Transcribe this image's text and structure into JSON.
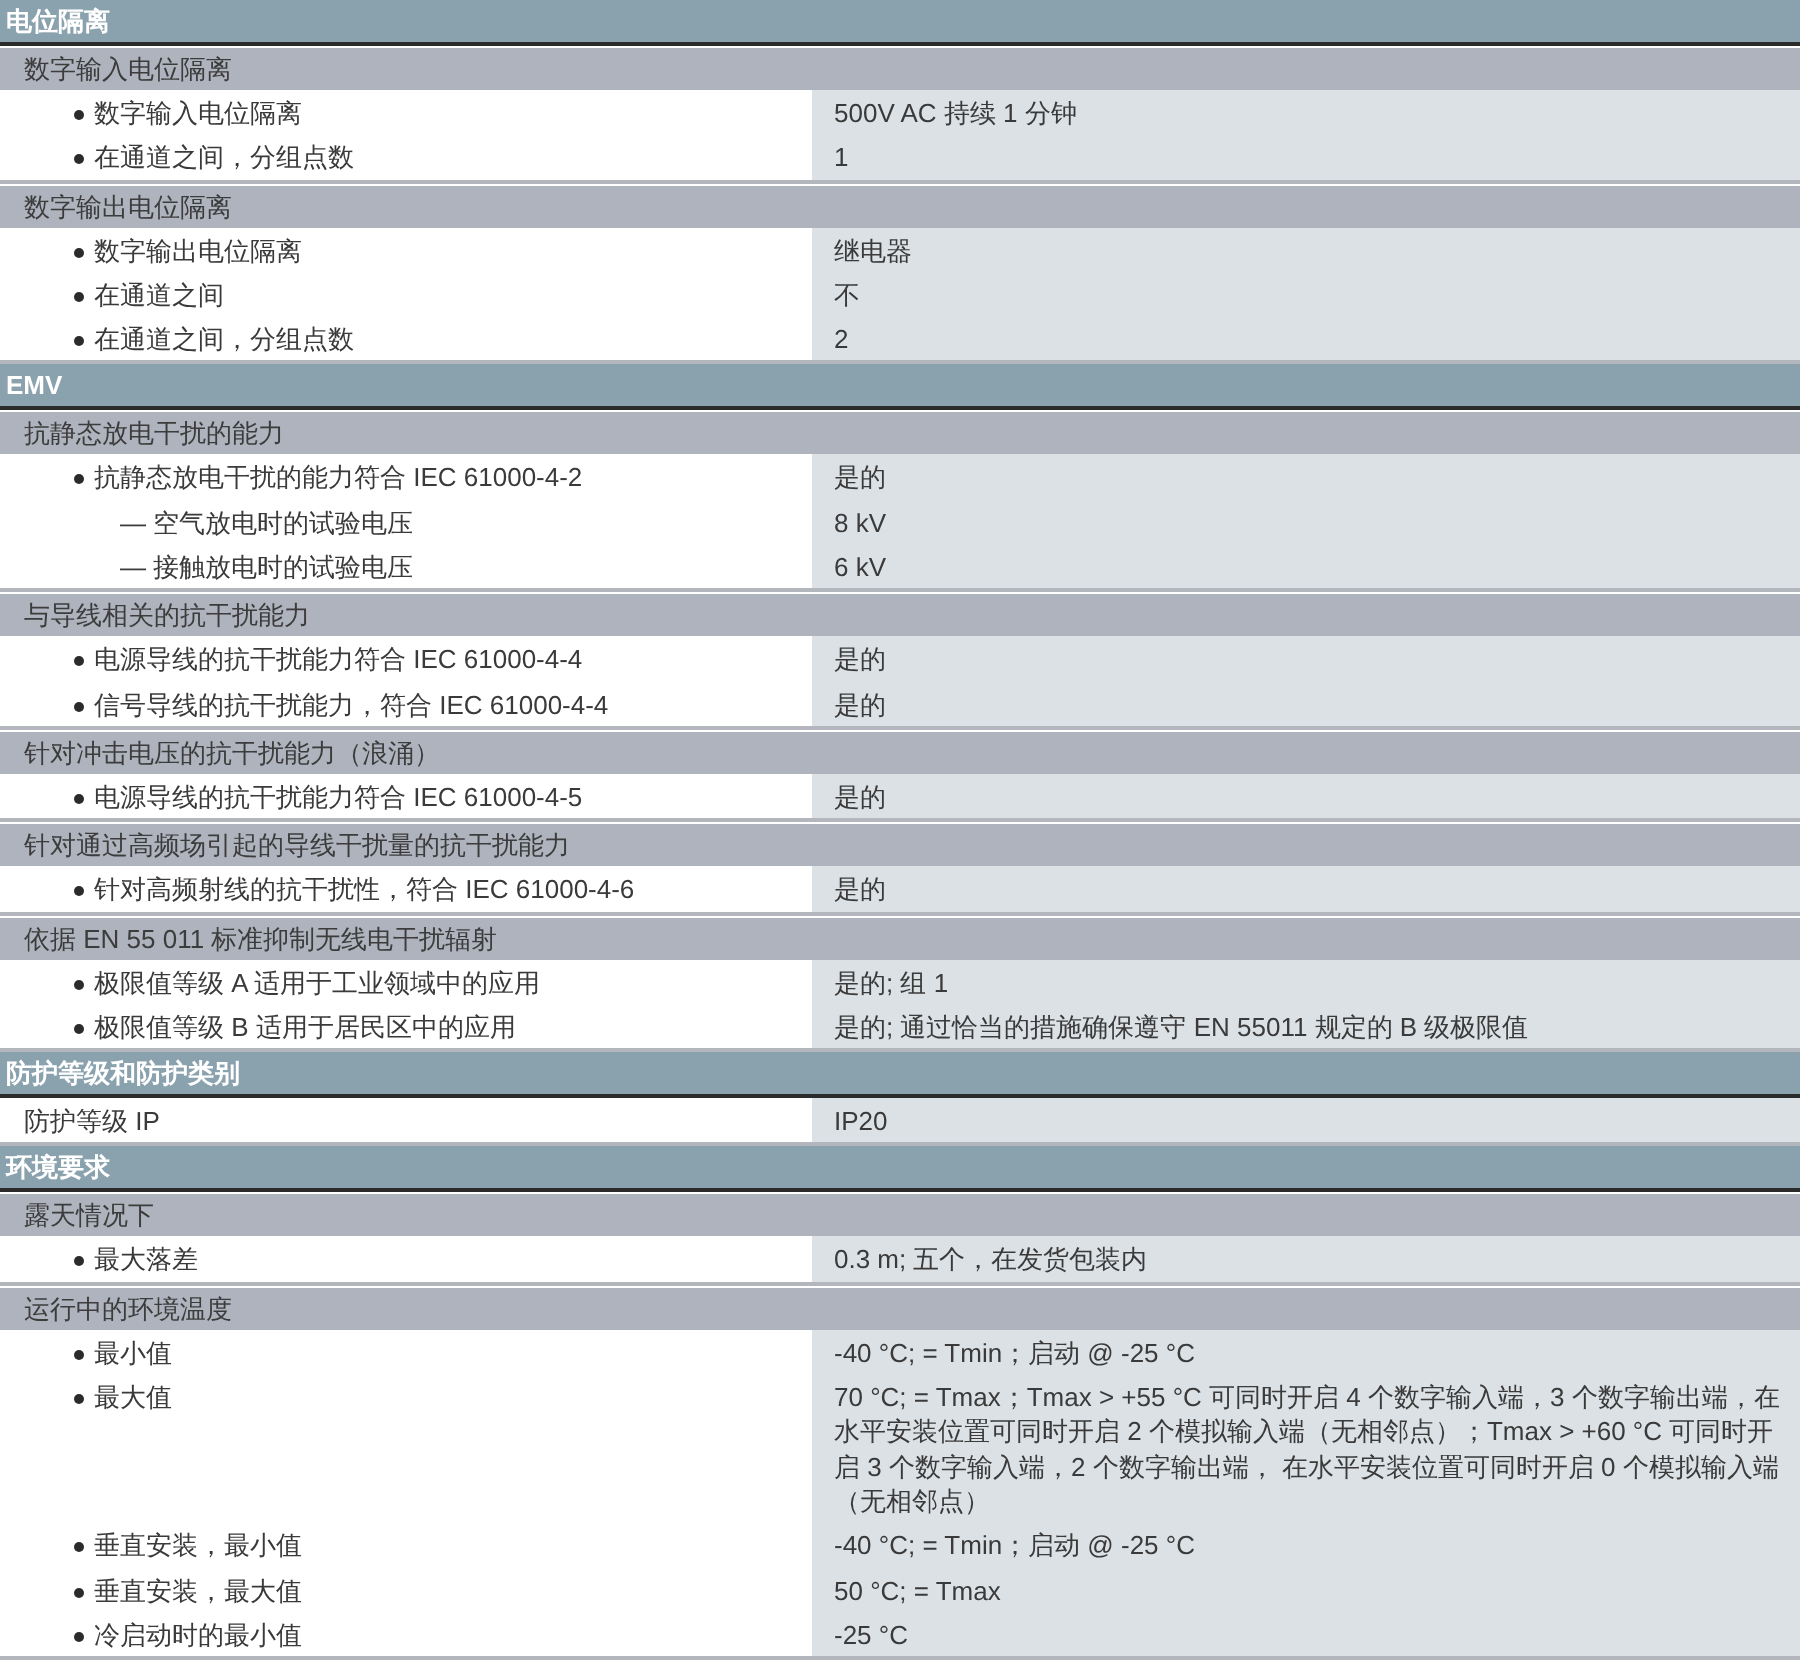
{
  "sections": [
    {
      "title": "电位隔离",
      "groups": [
        {
          "title": "数字输入电位隔离",
          "rows": [
            {
              "kind": "bullet",
              "label": "数字输入电位隔离",
              "value": "500V AC 持续 1 分钟"
            },
            {
              "kind": "bullet",
              "label": "在通道之间，分组点数",
              "value": "1"
            }
          ]
        },
        {
          "title": "数字输出电位隔离",
          "rows": [
            {
              "kind": "bullet",
              "label": "数字输出电位隔离",
              "value": "继电器"
            },
            {
              "kind": "bullet",
              "label": "在通道之间",
              "value": "不"
            },
            {
              "kind": "bullet",
              "label": "在通道之间，分组点数",
              "value": "2"
            }
          ]
        }
      ]
    },
    {
      "title": "EMV",
      "groups": [
        {
          "title": "抗静态放电干扰的能力",
          "rows": [
            {
              "kind": "bullet",
              "label": "抗静态放电干扰的能力符合 IEC 61000-4-2",
              "value": "是的"
            },
            {
              "kind": "dash",
              "label": "— 空气放电时的试验电压",
              "value": "8 kV"
            },
            {
              "kind": "dash",
              "label": "— 接触放电时的试验电压",
              "value": "6 kV"
            }
          ]
        },
        {
          "title": "与导线相关的抗干扰能力",
          "rows": [
            {
              "kind": "bullet",
              "label": "电源导线的抗干扰能力符合 IEC 61000-4-4",
              "value": "是的"
            },
            {
              "kind": "bullet",
              "label": "信号导线的抗干扰能力，符合 IEC 61000-4-4",
              "value": "是的"
            }
          ]
        },
        {
          "title": "针对冲击电压的抗干扰能力（浪涌）",
          "rows": [
            {
              "kind": "bullet",
              "label": "电源导线的抗干扰能力符合 IEC 61000-4-5",
              "value": "是的"
            }
          ]
        },
        {
          "title": "针对通过高频场引起的导线干扰量的抗干扰能力",
          "rows": [
            {
              "kind": "bullet",
              "label": "针对高频射线的抗干扰性，符合 IEC 61000-4-6",
              "value": "是的"
            }
          ]
        },
        {
          "title": "依据 EN 55 011 标准抑制无线电干扰辐射",
          "rows": [
            {
              "kind": "bullet",
              "label": "极限值等级 A 适用于工业领域中的应用",
              "value": "是的; 组 1"
            },
            {
              "kind": "bullet",
              "label": "极限值等级 B 适用于居民区中的应用",
              "value": "是的; 通过恰当的措施确保遵守 EN 55011 规定的 B 级极限值"
            }
          ]
        }
      ]
    },
    {
      "title": "防护等级和防护类别",
      "groups": [
        {
          "rows": [
            {
              "kind": "plain",
              "label": "防护等级 IP",
              "value": "IP20"
            }
          ]
        }
      ]
    },
    {
      "title": "环境要求",
      "groups": [
        {
          "title": "露天情况下",
          "rows": [
            {
              "kind": "bullet",
              "label": "最大落差",
              "value": "0.3 m; 五个，在发货包装内"
            }
          ]
        },
        {
          "title": "运行中的环境温度",
          "rows": [
            {
              "kind": "bullet",
              "label": "最小值",
              "value": "-40 °C; = Tmin；启动 @ -25 °C"
            },
            {
              "kind": "bullet",
              "label": "最大值",
              "value": "70 °C; = Tmax；Tmax > +55 °C 可同时开启 4 个数字输入端，3 个数字输出端，在水平安装位置可同时开启 2 个模拟输入端（无相邻点）；Tmax > +60 °C 可同时开启 3 个数字输入端，2 个数字输出端， 在水平安装位置可同时开启 0 个模拟输入端（无相邻点）"
            },
            {
              "kind": "bullet",
              "label": "垂直安装，最小值",
              "value": "-40 °C; = Tmin；启动 @ -25 °C"
            },
            {
              "kind": "bullet",
              "label": "垂直安装，最大值",
              "value": "50 °C; = Tmax"
            },
            {
              "kind": "bullet",
              "label": "冷启动时的最小值",
              "value": "-25 °C"
            }
          ]
        }
      ]
    }
  ]
}
